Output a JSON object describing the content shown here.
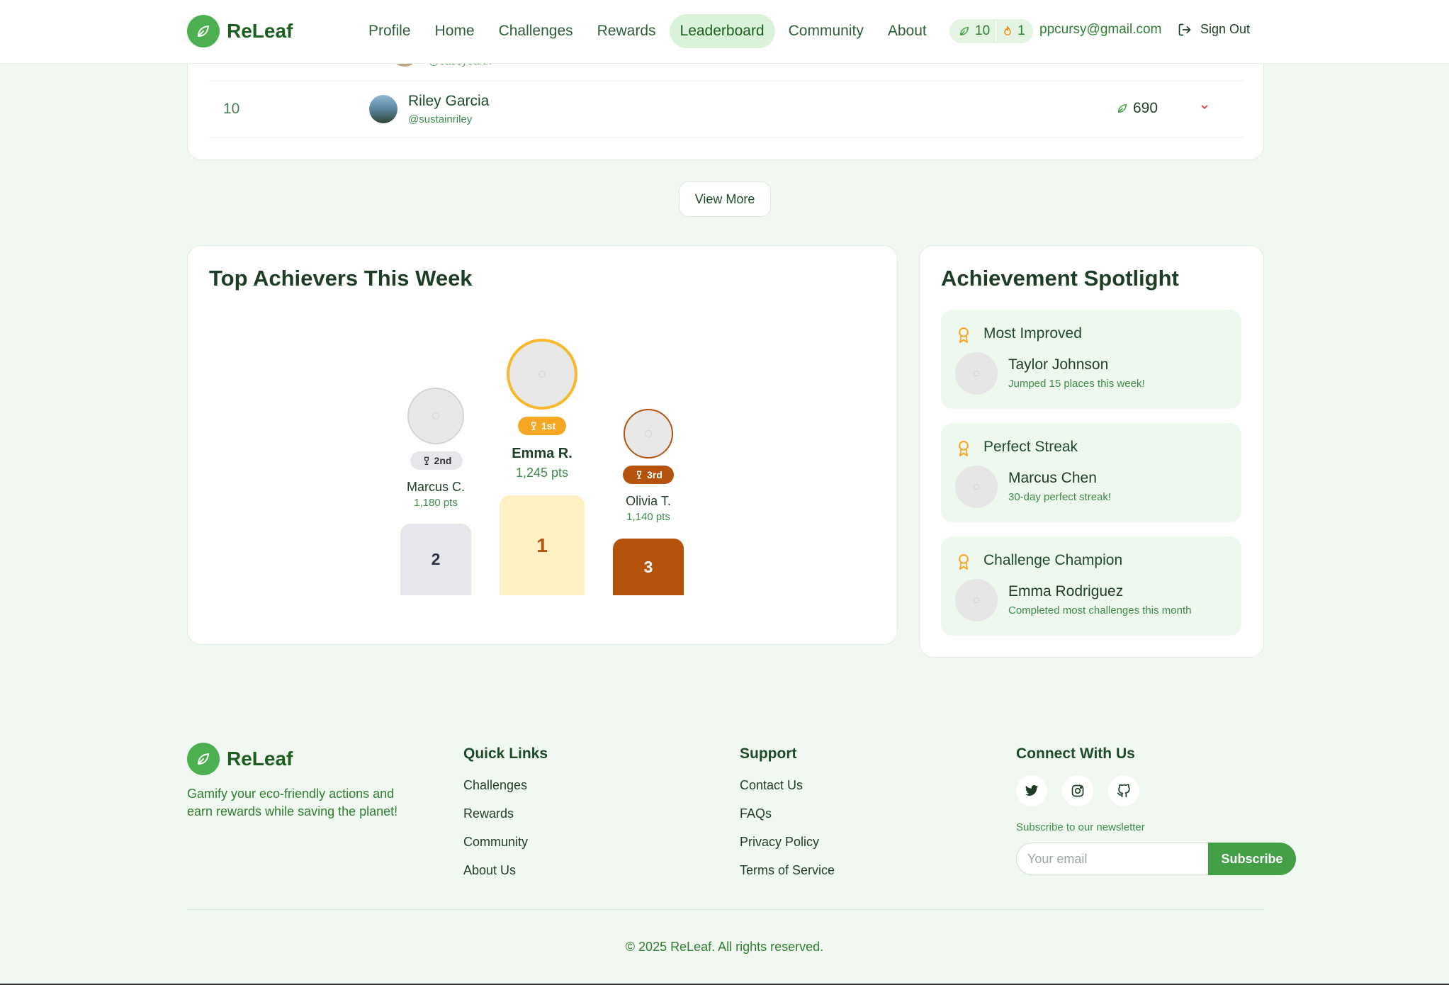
{
  "header": {
    "brand": "ReLeaf",
    "nav": [
      {
        "label": "Profile"
      },
      {
        "label": "Home"
      },
      {
        "label": "Challenges"
      },
      {
        "label": "Rewards"
      },
      {
        "label": "Leaderboard",
        "active": true
      },
      {
        "label": "Community"
      },
      {
        "label": "About"
      }
    ],
    "leaf_count": "10",
    "streak_count": "1",
    "user_email": "ppcursy@gmail.com",
    "sign_out_label": "Sign Out"
  },
  "leaderboard": {
    "partial_row": {
      "handle": "@caseyearth"
    },
    "rows": [
      {
        "rank": "10",
        "name": "Riley Garcia",
        "handle": "@sustainriley",
        "points": "690"
      }
    ],
    "view_more_label": "View More"
  },
  "top_achievers": {
    "title": "Top Achievers This Week",
    "podium": [
      {
        "place": "2nd",
        "name": "Marcus C.",
        "points": "1,180 pts",
        "block_label": "2"
      },
      {
        "place": "1st",
        "name": "Emma R.",
        "points": "1,245 pts",
        "block_label": "1"
      },
      {
        "place": "3rd",
        "name": "Olivia T.",
        "points": "1,140 pts",
        "block_label": "3"
      }
    ]
  },
  "spotlight": {
    "title": "Achievement Spotlight",
    "items": [
      {
        "award": "Most Improved",
        "name": "Taylor Johnson",
        "desc": "Jumped 15 places this week!"
      },
      {
        "award": "Perfect Streak",
        "name": "Marcus Chen",
        "desc": "30-day perfect streak!"
      },
      {
        "award": "Challenge Champion",
        "name": "Emma Rodriguez",
        "desc": "Completed most challenges this month"
      }
    ]
  },
  "footer": {
    "brand": "ReLeaf",
    "tagline": "Gamify your eco-friendly actions and earn rewards while saving the planet!",
    "quick_links": {
      "heading": "Quick Links",
      "items": [
        "Challenges",
        "Rewards",
        "Community",
        "About Us"
      ]
    },
    "support": {
      "heading": "Support",
      "items": [
        "Contact Us",
        "FAQs",
        "Privacy Policy",
        "Terms of Service"
      ]
    },
    "connect": {
      "heading": "Connect With Us",
      "socials": [
        "twitter-icon",
        "instagram-icon",
        "github-icon"
      ],
      "newsletter_label": "Subscribe to our newsletter",
      "email_placeholder": "Your email",
      "subscribe_label": "Subscribe"
    },
    "copyright": "© 2025 ReLeaf. All rights reserved."
  },
  "colors": {
    "brand_green": "#4caf50",
    "gold": "#f5b82e",
    "silver": "#e6e7eb",
    "bronze": "#b5530c",
    "page_bg": "#f1f8f1"
  }
}
